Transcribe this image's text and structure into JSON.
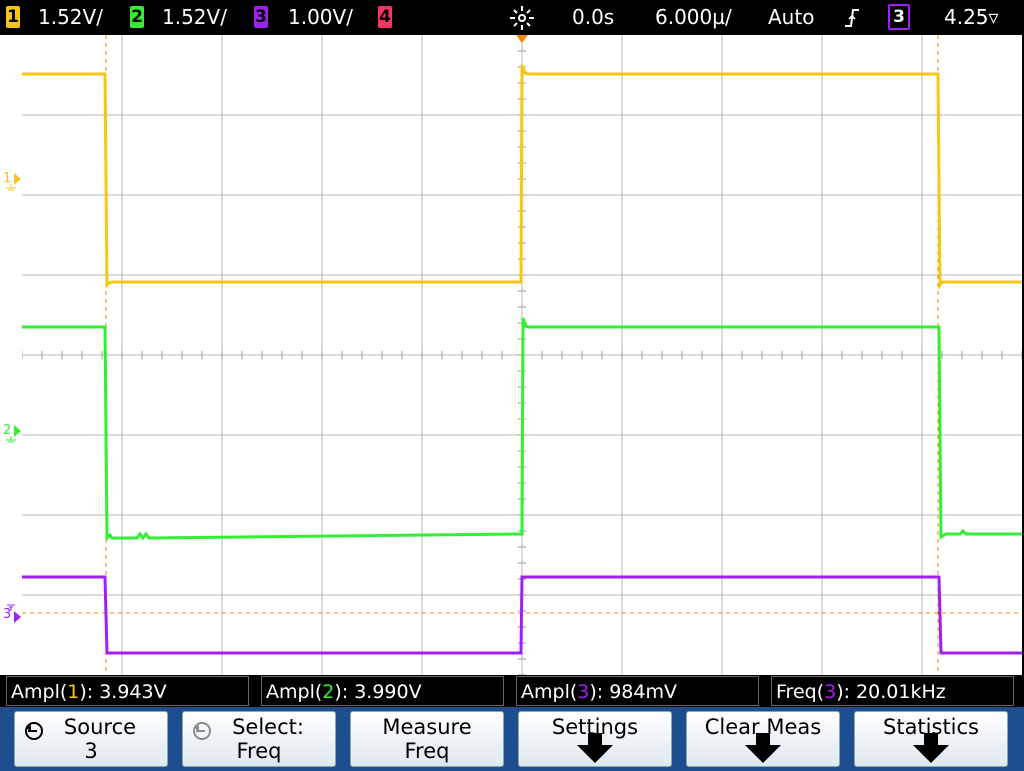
{
  "topbar": {
    "ch1": {
      "num": "1",
      "scale": "1.52V/",
      "color": "#f5c518"
    },
    "ch2": {
      "num": "2",
      "scale": "1.52V/",
      "color": "#33ee33"
    },
    "ch3": {
      "num": "3",
      "scale": "1.00V/",
      "color": "#a020f0"
    },
    "ch4": {
      "num": "4",
      "color": "#ff3366"
    },
    "delay": "0.0s",
    "timebase": "6.000µ/",
    "trigger_mode": "Auto",
    "trigger_slope_icon": "rising-edge-icon",
    "trigger_source": "3",
    "trigger_level": "4.25▿"
  },
  "markers": {
    "ch1": "1",
    "ch2": "2",
    "ch3": "3"
  },
  "measurements": [
    {
      "prefix": "Ampl(",
      "ch": "1",
      "suffix": "): 3.943V",
      "color": "#f5c518"
    },
    {
      "prefix": "Ampl(",
      "ch": "2",
      "suffix": "): 3.990V",
      "color": "#33ee33"
    },
    {
      "prefix": "Ampl(",
      "ch": "3",
      "suffix": "): 984mV",
      "color": "#a020f0"
    },
    {
      "prefix": "Freq(",
      "ch": "3",
      "suffix": "): 20.01kHz",
      "color": "#a020f0"
    }
  ],
  "softkeys": [
    {
      "line1": "Source",
      "line2": "3"
    },
    {
      "line1": "Select:",
      "line2": "Freq"
    },
    {
      "line1": "Measure",
      "line2": "Freq"
    },
    {
      "line1": "Settings",
      "line2": ""
    },
    {
      "line1": "Clear Meas",
      "line2": ""
    },
    {
      "line1": "Statistics",
      "line2": ""
    }
  ],
  "colors": {
    "ch1": "#f5c518",
    "ch2": "#33ee33",
    "ch3": "#a020f0",
    "grid": "#b0b0b0",
    "trigger_line": "#f08a00",
    "softkey_bar": "#1f4e8f"
  }
}
